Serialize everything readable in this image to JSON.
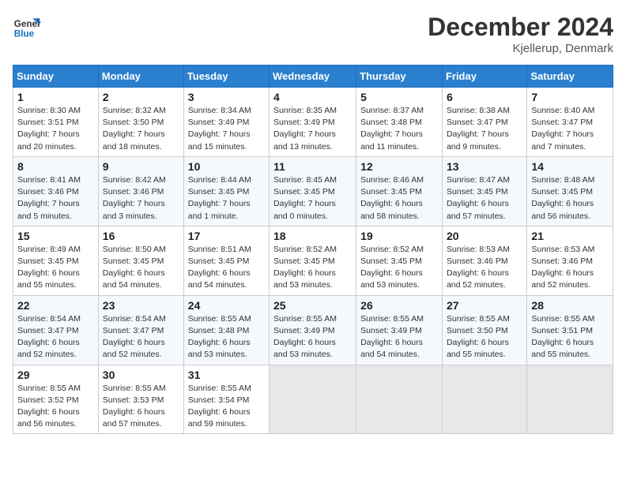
{
  "logo": {
    "line1": "General",
    "line2": "Blue"
  },
  "title": "December 2024",
  "location": "Kjellerup, Denmark",
  "days_of_week": [
    "Sunday",
    "Monday",
    "Tuesday",
    "Wednesday",
    "Thursday",
    "Friday",
    "Saturday"
  ],
  "weeks": [
    [
      {
        "day": "1",
        "sunrise": "8:30 AM",
        "sunset": "3:51 PM",
        "daylight": "7 hours and 20 minutes."
      },
      {
        "day": "2",
        "sunrise": "8:32 AM",
        "sunset": "3:50 PM",
        "daylight": "7 hours and 18 minutes."
      },
      {
        "day": "3",
        "sunrise": "8:34 AM",
        "sunset": "3:49 PM",
        "daylight": "7 hours and 15 minutes."
      },
      {
        "day": "4",
        "sunrise": "8:35 AM",
        "sunset": "3:49 PM",
        "daylight": "7 hours and 13 minutes."
      },
      {
        "day": "5",
        "sunrise": "8:37 AM",
        "sunset": "3:48 PM",
        "daylight": "7 hours and 11 minutes."
      },
      {
        "day": "6",
        "sunrise": "8:38 AM",
        "sunset": "3:47 PM",
        "daylight": "7 hours and 9 minutes."
      },
      {
        "day": "7",
        "sunrise": "8:40 AM",
        "sunset": "3:47 PM",
        "daylight": "7 hours and 7 minutes."
      }
    ],
    [
      {
        "day": "8",
        "sunrise": "8:41 AM",
        "sunset": "3:46 PM",
        "daylight": "7 hours and 5 minutes."
      },
      {
        "day": "9",
        "sunrise": "8:42 AM",
        "sunset": "3:46 PM",
        "daylight": "7 hours and 3 minutes."
      },
      {
        "day": "10",
        "sunrise": "8:44 AM",
        "sunset": "3:45 PM",
        "daylight": "7 hours and 1 minute."
      },
      {
        "day": "11",
        "sunrise": "8:45 AM",
        "sunset": "3:45 PM",
        "daylight": "7 hours and 0 minutes."
      },
      {
        "day": "12",
        "sunrise": "8:46 AM",
        "sunset": "3:45 PM",
        "daylight": "6 hours and 58 minutes."
      },
      {
        "day": "13",
        "sunrise": "8:47 AM",
        "sunset": "3:45 PM",
        "daylight": "6 hours and 57 minutes."
      },
      {
        "day": "14",
        "sunrise": "8:48 AM",
        "sunset": "3:45 PM",
        "daylight": "6 hours and 56 minutes."
      }
    ],
    [
      {
        "day": "15",
        "sunrise": "8:49 AM",
        "sunset": "3:45 PM",
        "daylight": "6 hours and 55 minutes."
      },
      {
        "day": "16",
        "sunrise": "8:50 AM",
        "sunset": "3:45 PM",
        "daylight": "6 hours and 54 minutes."
      },
      {
        "day": "17",
        "sunrise": "8:51 AM",
        "sunset": "3:45 PM",
        "daylight": "6 hours and 54 minutes."
      },
      {
        "day": "18",
        "sunrise": "8:52 AM",
        "sunset": "3:45 PM",
        "daylight": "6 hours and 53 minutes."
      },
      {
        "day": "19",
        "sunrise": "8:52 AM",
        "sunset": "3:45 PM",
        "daylight": "6 hours and 53 minutes."
      },
      {
        "day": "20",
        "sunrise": "8:53 AM",
        "sunset": "3:46 PM",
        "daylight": "6 hours and 52 minutes."
      },
      {
        "day": "21",
        "sunrise": "8:53 AM",
        "sunset": "3:46 PM",
        "daylight": "6 hours and 52 minutes."
      }
    ],
    [
      {
        "day": "22",
        "sunrise": "8:54 AM",
        "sunset": "3:47 PM",
        "daylight": "6 hours and 52 minutes."
      },
      {
        "day": "23",
        "sunrise": "8:54 AM",
        "sunset": "3:47 PM",
        "daylight": "6 hours and 52 minutes."
      },
      {
        "day": "24",
        "sunrise": "8:55 AM",
        "sunset": "3:48 PM",
        "daylight": "6 hours and 53 minutes."
      },
      {
        "day": "25",
        "sunrise": "8:55 AM",
        "sunset": "3:49 PM",
        "daylight": "6 hours and 53 minutes."
      },
      {
        "day": "26",
        "sunrise": "8:55 AM",
        "sunset": "3:49 PM",
        "daylight": "6 hours and 54 minutes."
      },
      {
        "day": "27",
        "sunrise": "8:55 AM",
        "sunset": "3:50 PM",
        "daylight": "6 hours and 55 minutes."
      },
      {
        "day": "28",
        "sunrise": "8:55 AM",
        "sunset": "3:51 PM",
        "daylight": "6 hours and 55 minutes."
      }
    ],
    [
      {
        "day": "29",
        "sunrise": "8:55 AM",
        "sunset": "3:52 PM",
        "daylight": "6 hours and 56 minutes."
      },
      {
        "day": "30",
        "sunrise": "8:55 AM",
        "sunset": "3:53 PM",
        "daylight": "6 hours and 57 minutes."
      },
      {
        "day": "31",
        "sunrise": "8:55 AM",
        "sunset": "3:54 PM",
        "daylight": "6 hours and 59 minutes."
      },
      null,
      null,
      null,
      null
    ]
  ]
}
